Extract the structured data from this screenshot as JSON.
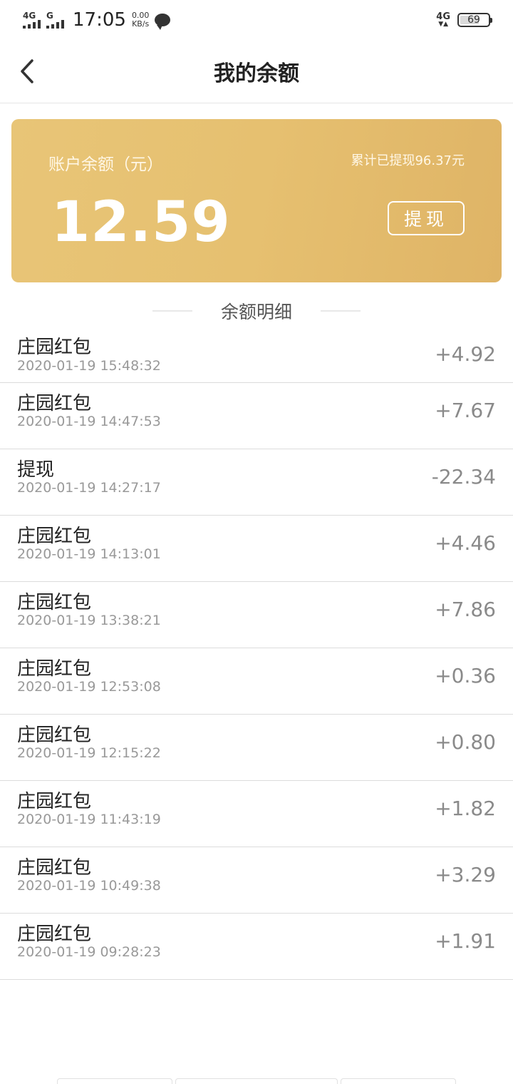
{
  "status_bar": {
    "net1": "4G",
    "net2": "G",
    "time": "17:05",
    "speed_value": "0.00",
    "speed_unit": "KB/s",
    "right_net": "4G",
    "battery": "69",
    "battery_level": 0.69
  },
  "header": {
    "title": "我的余额"
  },
  "card": {
    "label": "账户余额（元）",
    "withdrawn_text": "累计已提现96.37元",
    "amount": "12.59",
    "withdraw_button": "提现"
  },
  "section": {
    "title": "余额明细"
  },
  "records": [
    {
      "title": "庄园红包",
      "time": "2020-01-19 15:48:32",
      "amount": "+4.92"
    },
    {
      "title": "庄园红包",
      "time": "2020-01-19 14:47:53",
      "amount": "+7.67"
    },
    {
      "title": "提现",
      "time": "2020-01-19 14:27:17",
      "amount": "-22.34"
    },
    {
      "title": "庄园红包",
      "time": "2020-01-19 14:13:01",
      "amount": "+4.46"
    },
    {
      "title": "庄园红包",
      "time": "2020-01-19 13:38:21",
      "amount": "+7.86"
    },
    {
      "title": "庄园红包",
      "time": "2020-01-19 12:53:08",
      "amount": "+0.36"
    },
    {
      "title": "庄园红包",
      "time": "2020-01-19 12:15:22",
      "amount": "+0.80"
    },
    {
      "title": "庄园红包",
      "time": "2020-01-19 11:43:19",
      "amount": "+1.82"
    },
    {
      "title": "庄园红包",
      "time": "2020-01-19 10:49:38",
      "amount": "+3.29"
    },
    {
      "title": "庄园红包",
      "time": "2020-01-19 09:28:23",
      "amount": "+1.91"
    }
  ],
  "colors": {
    "card_gold": "#e6c070",
    "amount_gray": "#8a8a8a"
  }
}
